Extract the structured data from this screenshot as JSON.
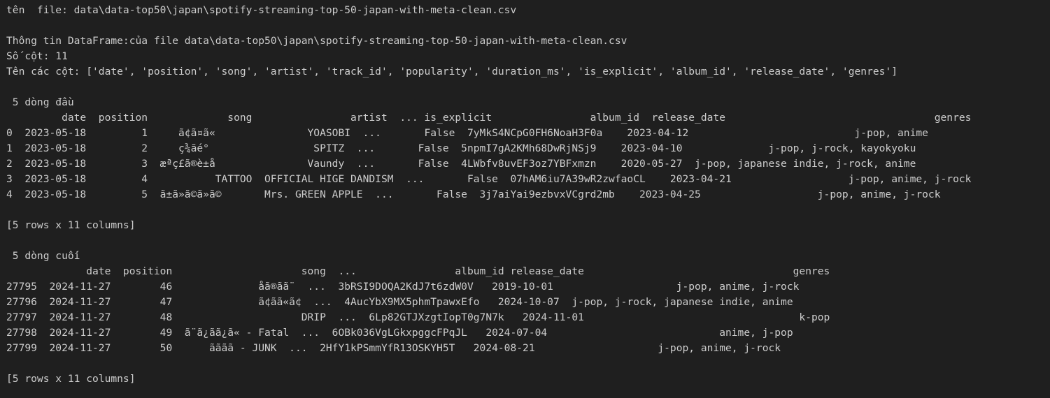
{
  "terminal": {
    "lines": [
      "tên  file: data\\data-top50\\japan\\spotify-streaming-top-50-japan-with-meta-clean.csv",
      "",
      "Thông tin DataFrame:của file data\\data-top50\\japan\\spotify-streaming-top-50-japan-with-meta-clean.csv",
      "Số cột: 11",
      "Tên các cột: ['date', 'position', 'song', 'artist', 'track_id', 'popularity', 'duration_ms', 'is_explicit', 'album_id', 'release_date', 'genres']",
      "",
      " 5 dòng đầu",
      "         date  position             song                artist  ... is_explicit                album_id  release_date                                  genres",
      "0  2023-05-18         1     ã¢ã¤ã«               YOASOBI  ...       False  7yMkS4NCpG0FH6NoaH3F0a    2023-04-12                           j-pop, anime",
      "1  2023-05-18         2     ç¾ãé°                 SPITZ  ...       False  5npmI7gA2KMh68DwRjNSj9    2023-04-10              j-pop, j-rock, kayokyoku",
      "2  2023-05-18         3  æªç£ã®è±å               Vaundy  ...       False  4LWbfv8uvEF3oz7YBFxmzn    2020-05-27  j-pop, japanese indie, j-rock, anime",
      "3  2023-05-18         4           TATTOO  OFFICIAL HIGE DANDISM  ...       False  07hAM6iu7A39wR2zwfaoCL    2023-04-21                   j-pop, anime, j-rock",
      "4  2023-05-18         5  ã±ã»ã©ã»ã©       Mrs. GREEN APPLE  ...       False  3j7aiYai9ezbvxVCgrd2mb    2023-04-25                   j-pop, anime, j-rock",
      "",
      "[5 rows x 11 columns]",
      "",
      " 5 dòng cuối",
      "             date  position                     song  ...                album_id release_date                                  genres",
      "27795  2024-11-27        46              åã®ãã¨  ...  3bRSI9DOQA2KdJ7t6zdW0V   2019-10-01                    j-pop, anime, j-rock",
      "27796  2024-11-27        47              ã¢ãã«ã¢  ...  4AucYbX9MX5phmTpawxEfo   2024-10-07  j-pop, j-rock, japanese indie, anime",
      "27797  2024-11-27        48                     DRIP  ...  6Lp82GTJXzgtIopT0g7N7k   2024-11-01                                   k-pop",
      "27798  2024-11-27        49  ã¨ã¿ãã¿ã« - Fatal  ...  6OBk036VgLGkxpggcFPqJL   2024-07-04                            anime, j-pop",
      "27799  2024-11-27        50      ãããã - JUNK  ...  2HfY1kPSmmYfR13OSKYH5T   2024-08-21                    j-pop, anime, j-rock",
      "",
      "[5 rows x 11 columns]"
    ]
  }
}
